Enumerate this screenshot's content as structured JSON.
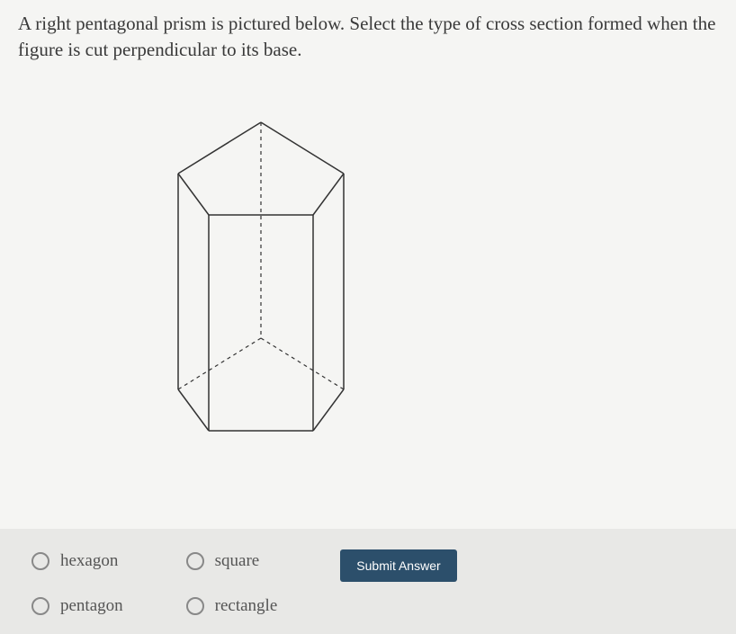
{
  "question": {
    "text": "A right pentagonal prism is pictured below. Select the type of cross section formed when the figure is cut perpendicular to its base."
  },
  "options": [
    {
      "label": "hexagon"
    },
    {
      "label": "square"
    },
    {
      "label": "pentagon"
    },
    {
      "label": "rectangle"
    }
  ],
  "submit": {
    "label": "Submit Answer"
  }
}
